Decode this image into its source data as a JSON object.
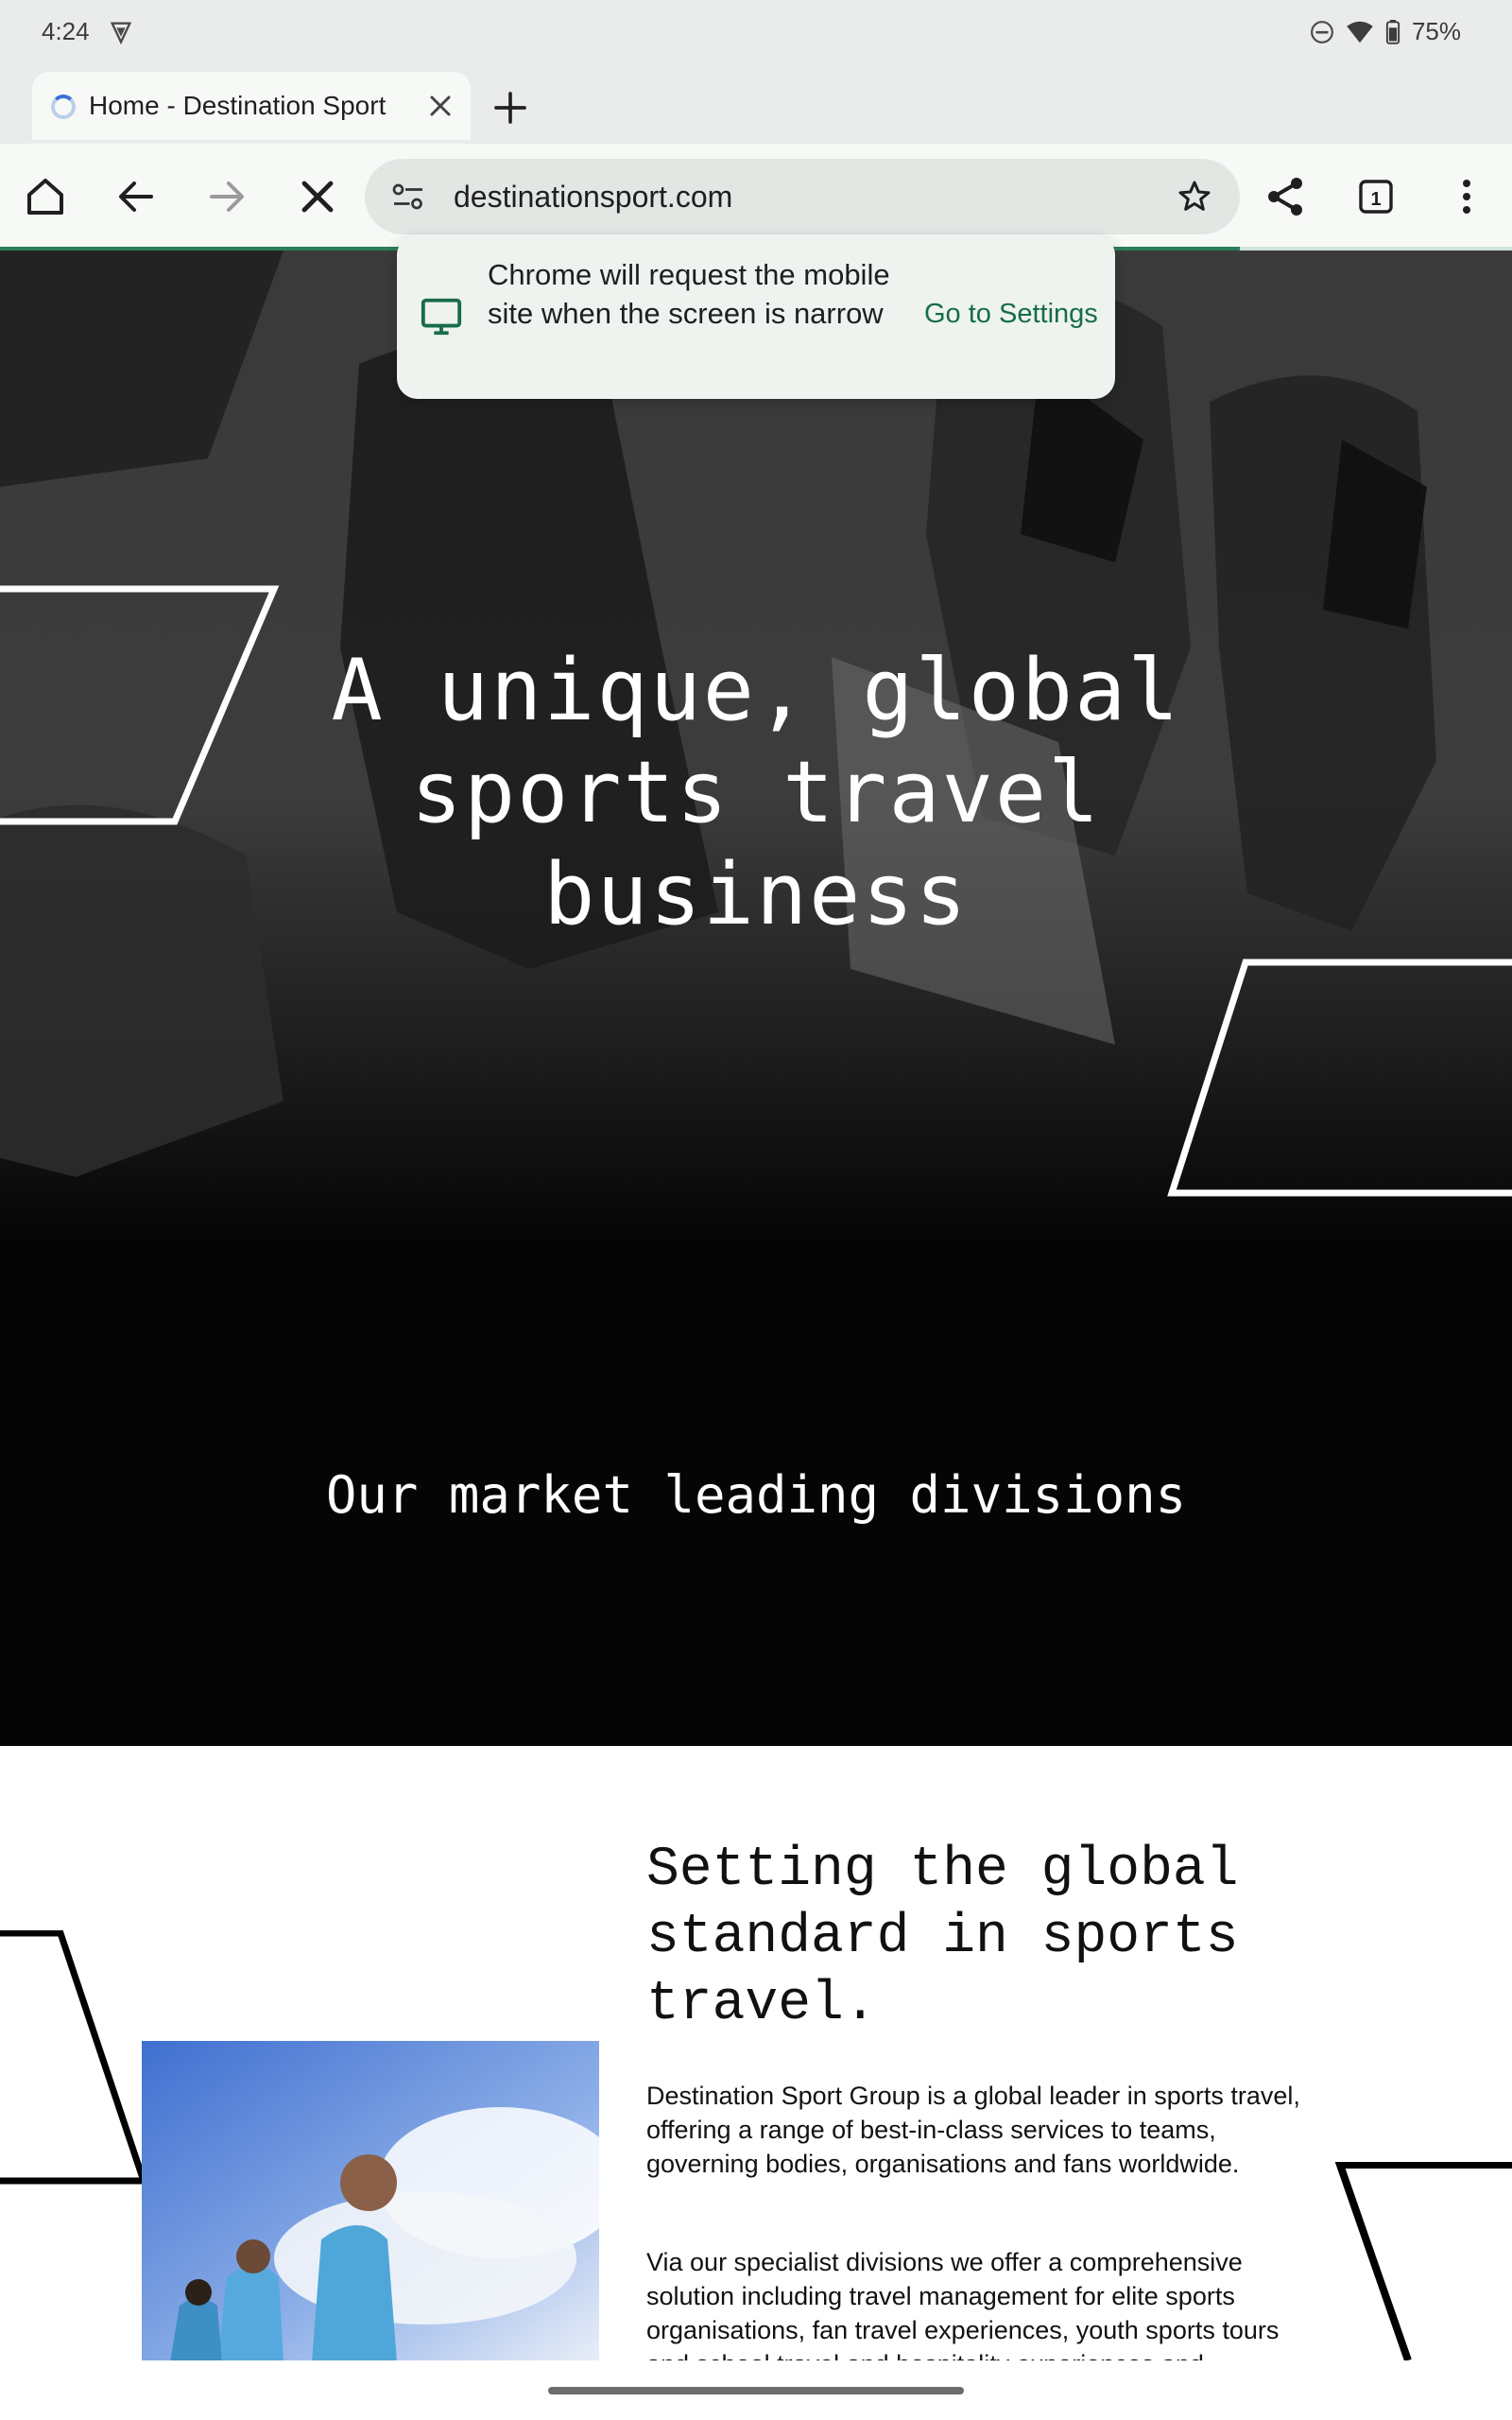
{
  "status_bar": {
    "time": "4:24",
    "battery": "75%",
    "icons": [
      "vpn-shield-icon",
      "do-not-disturb-icon",
      "wifi-icon",
      "battery-icon"
    ]
  },
  "browser": {
    "tab_title": "Home - Destination Sport",
    "url": "destinationsport.com",
    "tab_count": "1",
    "load_progress": 0.82,
    "icons": [
      "home-icon",
      "back-icon",
      "forward-icon",
      "stop-icon",
      "tune-icon",
      "star-icon",
      "share-icon",
      "tab-switcher-icon",
      "menu-icon"
    ]
  },
  "popup": {
    "message": "Chrome will request the mobile site when the screen is narrow",
    "action": "Go to Settings",
    "icon": "desktop-icon"
  },
  "page": {
    "hero_title": "A unique, global\nsports travel\nbusiness",
    "divisions_heading": "Our market leading divisions",
    "about_heading": "Setting the global\nstandard in sports\ntravel.",
    "about_p1": "Destination Sport Group is a global leader in sports travel, offering a range of best-in-class services to teams, governing bodies, organisations and fans worldwide.",
    "about_p2": "Via our specialist divisions we offer a comprehensive solution including travel management for elite sports organisations, fan travel experiences, youth sports tours and school travel and hospitality experiences and"
  },
  "colors": {
    "accent_green": "#176c4a",
    "progress_green": "#2e7d5b",
    "hero_background": "#050505"
  }
}
